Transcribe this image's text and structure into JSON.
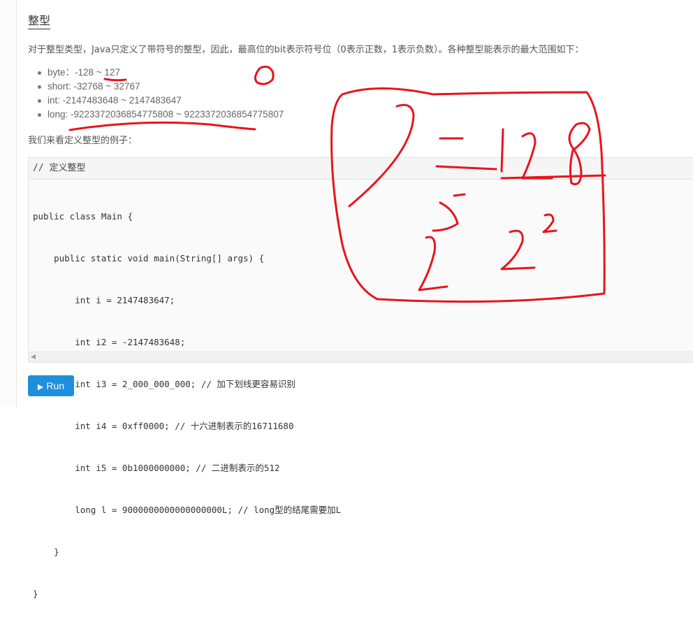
{
  "section": {
    "title": "整型"
  },
  "intro": "对于整型类型，Java只定义了带符号的整型，因此，最高位的bit表示符号位（0表示正数，1表示负数）。各种整型能表示的最大范围如下：",
  "types": [
    {
      "text": "byte：-128 ~ 127"
    },
    {
      "text": "short: -32768 ~ 32767"
    },
    {
      "text": "int: -2147483648 ~ 2147483647"
    },
    {
      "text": "long: -9223372036854775808 ~ 9223372036854775807"
    }
  ],
  "example_lead": "我们来看定义整型的例子：",
  "code": {
    "header": "// 定义整型",
    "lines": [
      "public class Main {",
      "    public static void main(String[] args) {",
      "        int i = 2147483647;",
      "        int i2 = -2147483648;",
      "        int i3 = 2_000_000_000; // 加下划线更容易识别",
      "        int i4 = 0xff0000; // 十六进制表示的16711680",
      "        int i5 = 0b1000000000; // 二进制表示的512",
      "        long l = 9000000000000000000L; // long型的结尾需要加L",
      "    }",
      "}"
    ],
    "scroll_left_icon": "triangle-left-icon"
  },
  "run_button": {
    "label": "Run",
    "icon": "play-icon"
  },
  "colors": {
    "run_button": "#1e8fdb",
    "annotation": "#e8141c"
  }
}
